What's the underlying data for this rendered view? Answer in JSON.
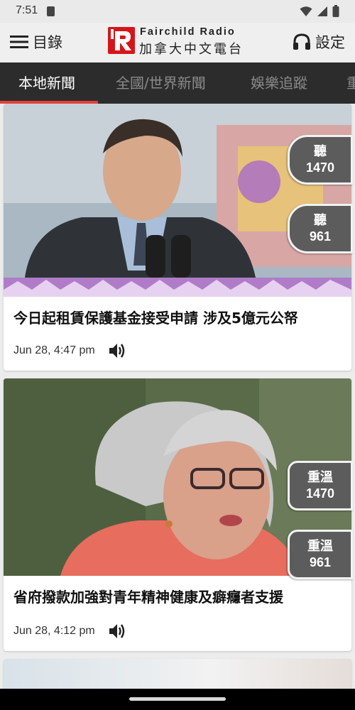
{
  "status_bar": {
    "time": "7:51"
  },
  "header": {
    "menu_label": "目錄",
    "logo_en": "Fairchild Radio",
    "logo_zh": "加拿大中文電台",
    "settings_label": "設定"
  },
  "tabs": [
    {
      "label": "本地新聞",
      "active": true
    },
    {
      "label": "全國/世界新聞",
      "active": false
    },
    {
      "label": "娛樂追蹤",
      "active": false
    },
    {
      "label": "重",
      "active": false
    }
  ],
  "articles": [
    {
      "title": "今日起租賃保護基金接受申請 涉及5億元公帑",
      "date": "Jun 28, 4:47 pm",
      "buttons": [
        {
          "top": "聽",
          "bottom": "1470"
        },
        {
          "top": "聽",
          "bottom": "961"
        }
      ]
    },
    {
      "title": "省府撥款加強對青年精神健康及癖癮者支援",
      "date": "Jun 28, 4:12 pm",
      "buttons": [
        {
          "top": "重溫",
          "bottom": "1470"
        },
        {
          "top": "重溫",
          "bottom": "961"
        }
      ]
    }
  ],
  "colors": {
    "accent": "#e0413a",
    "tab_bg": "#2c2c2c",
    "brand_red": "#d4161a"
  },
  "icons": [
    "menu-icon",
    "logo-icon",
    "headphones-icon",
    "speaker-icon",
    "wifi-icon",
    "signal-icon",
    "battery-icon",
    "sim-icon"
  ]
}
